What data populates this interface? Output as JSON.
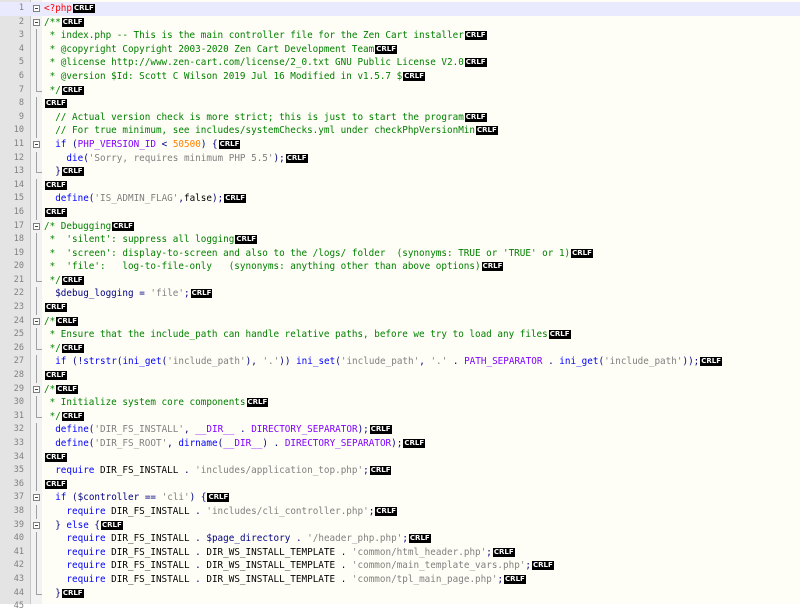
{
  "editor": {
    "eol_marker": "CRLF",
    "current_line": 1,
    "colors": {
      "comment": "#008000",
      "keyword": "#0000ff",
      "string": "#808080",
      "number": "#ff8000",
      "constant": "#8000ff",
      "php_tag": "#ff0000",
      "current_line_bg": "#eaeaff",
      "background": "#fffef6"
    },
    "lines": [
      {
        "n": "1",
        "fold": "open",
        "t": "<?php"
      },
      {
        "n": "2",
        "fold": "open",
        "t": "/**"
      },
      {
        "n": "3",
        "fold": "line",
        "t": " * index.php -- This is the main controller file for the Zen Cart installer"
      },
      {
        "n": "4",
        "fold": "line",
        "t": " * @copyright Copyright 2003-2020 Zen Cart Development Team"
      },
      {
        "n": "5",
        "fold": "line",
        "t": " * @license http://www.zen-cart.com/license/2_0.txt GNU Public License V2.0"
      },
      {
        "n": "6",
        "fold": "line",
        "t": " * @version $Id: Scott C Wilson 2019 Jul 16 Modified in v1.5.7 $"
      },
      {
        "n": "7",
        "fold": "end",
        "t": " */"
      },
      {
        "n": "8",
        "fold": "line",
        "t": ""
      },
      {
        "n": "9",
        "fold": "line",
        "t": "  // Actual version check is more strict; this is just to start the program"
      },
      {
        "n": "10",
        "fold": "line",
        "t": "  // For true minimum, see includes/systemChecks.yml under checkPhpVersionMin"
      },
      {
        "n": "11",
        "fold": "open",
        "t": "  if (PHP_VERSION_ID < 50500) {"
      },
      {
        "n": "12",
        "fold": "line",
        "t": "    die('Sorry, requires minimum PHP 5.5');"
      },
      {
        "n": "13",
        "fold": "end",
        "t": "  }"
      },
      {
        "n": "14",
        "fold": "line",
        "t": ""
      },
      {
        "n": "15",
        "fold": "line",
        "t": "  define('IS_ADMIN_FLAG',false);"
      },
      {
        "n": "16",
        "fold": "line",
        "t": ""
      },
      {
        "n": "17",
        "fold": "open",
        "t": "/* Debugging"
      },
      {
        "n": "18",
        "fold": "line",
        "t": " *  'silent': suppress all logging"
      },
      {
        "n": "19",
        "fold": "line",
        "t": " *  'screen': display-to-screen and also to the /logs/ folder  (synonyms: TRUE or 'TRUE' or 1)"
      },
      {
        "n": "20",
        "fold": "line",
        "t": " *  'file':   log-to-file-only   (synonyms: anything other than above options)"
      },
      {
        "n": "21",
        "fold": "end",
        "t": " */"
      },
      {
        "n": "22",
        "fold": "line",
        "t": "  $debug_logging = 'file';"
      },
      {
        "n": "23",
        "fold": "line",
        "t": ""
      },
      {
        "n": "24",
        "fold": "open",
        "t": "/*"
      },
      {
        "n": "25",
        "fold": "line",
        "t": " * Ensure that the include_path can handle relative paths, before we try to load any files"
      },
      {
        "n": "26",
        "fold": "end",
        "t": " */"
      },
      {
        "n": "27",
        "fold": "line",
        "t": "  if (!strstr(ini_get('include_path'), '.')) ini_set('include_path', '.' . PATH_SEPARATOR . ini_get('include_path'));"
      },
      {
        "n": "28",
        "fold": "line",
        "t": ""
      },
      {
        "n": "29",
        "fold": "open",
        "t": "/*"
      },
      {
        "n": "30",
        "fold": "line",
        "t": " * Initialize system core components"
      },
      {
        "n": "31",
        "fold": "end",
        "t": " */"
      },
      {
        "n": "32",
        "fold": "line",
        "t": "  define('DIR_FS_INSTALL', __DIR__ . DIRECTORY_SEPARATOR);"
      },
      {
        "n": "33",
        "fold": "line",
        "t": "  define('DIR_FS_ROOT', dirname(__DIR__) . DIRECTORY_SEPARATOR);"
      },
      {
        "n": "34",
        "fold": "line",
        "t": ""
      },
      {
        "n": "35",
        "fold": "line",
        "t": "  require DIR_FS_INSTALL . 'includes/application_top.php';"
      },
      {
        "n": "36",
        "fold": "line",
        "t": ""
      },
      {
        "n": "37",
        "fold": "open",
        "t": "  if ($controller == 'cli') {"
      },
      {
        "n": "38",
        "fold": "line",
        "t": "    require DIR_FS_INSTALL . 'includes/cli_controller.php';"
      },
      {
        "n": "39",
        "fold": "open",
        "t": "  } else {"
      },
      {
        "n": "40",
        "fold": "line",
        "t": "    require DIR_FS_INSTALL . $page_directory . '/header_php.php';"
      },
      {
        "n": "41",
        "fold": "line",
        "t": "    require DIR_FS_INSTALL . DIR_WS_INSTALL_TEMPLATE . 'common/html_header.php';"
      },
      {
        "n": "42",
        "fold": "line",
        "t": "    require DIR_FS_INSTALL . DIR_WS_INSTALL_TEMPLATE . 'common/main_template_vars.php';"
      },
      {
        "n": "43",
        "fold": "line",
        "t": "    require DIR_FS_INSTALL . DIR_WS_INSTALL_TEMPLATE . 'common/tpl_main_page.php';"
      },
      {
        "n": "44",
        "fold": "end",
        "t": "  }"
      },
      {
        "n": "45",
        "fold": "none",
        "t": ""
      }
    ]
  }
}
